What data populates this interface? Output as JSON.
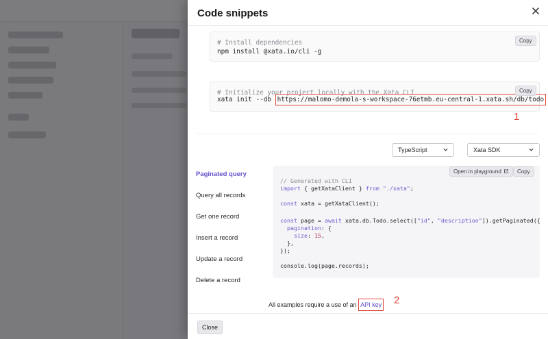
{
  "modal": {
    "title": "Code snippets",
    "install_block": {
      "comment": "# Install dependencies",
      "command": "npm install @xata.io/cli -g",
      "copy_label": "Copy"
    },
    "init_block": {
      "comment": "# Initialize your project locally with the Xata CLI",
      "command_prefix": "xata init --db ",
      "db_url": "https://malomo-demola-s-workspace-76etmb.eu-central-1.xata.sh/db/todo",
      "copy_label": "Copy"
    },
    "annotations": {
      "one": "1",
      "two": "2"
    },
    "language_select": {
      "value": "TypeScript"
    },
    "sdk_select": {
      "value": "Xata SDK"
    },
    "examples_nav": [
      {
        "label": "Paginated query",
        "active": true
      },
      {
        "label": "Query all records",
        "active": false
      },
      {
        "label": "Get one record",
        "active": false
      },
      {
        "label": "Insert a record",
        "active": false
      },
      {
        "label": "Update a record",
        "active": false
      },
      {
        "label": "Delete a record",
        "active": false
      }
    ],
    "snippet": {
      "playground_label": "Open in playground",
      "copy_label": "Copy",
      "l1": "// Generated with CLI",
      "l2_kw": "import",
      "l2_mid": " { getXataClient } ",
      "l2_from": "from",
      "l2_str": " \"./xata\"",
      "l2_end": ";",
      "l3_kw": "const",
      "l3_rest": " xata = getXataClient();",
      "l4_kw": "const",
      "l4_a": " page = ",
      "l4_await": "await",
      "l4_b": " xata.db.Todo.select([",
      "l4_s1": "\"id\"",
      "l4_c": ", ",
      "l4_s2": "\"description\"",
      "l4_d": "]).getPaginated({",
      "l5_key": "  pagination",
      "l5_rest": ": {",
      "l6_key": "    size",
      "l6_colon": ": ",
      "l6_num": "15",
      "l6_end": ",",
      "l7": "  },",
      "l8": "});",
      "l9": "console.log(page.records);"
    },
    "footer_text": "All examples require a use of an ",
    "api_key_link": "API key",
    "close_label": "Close"
  }
}
